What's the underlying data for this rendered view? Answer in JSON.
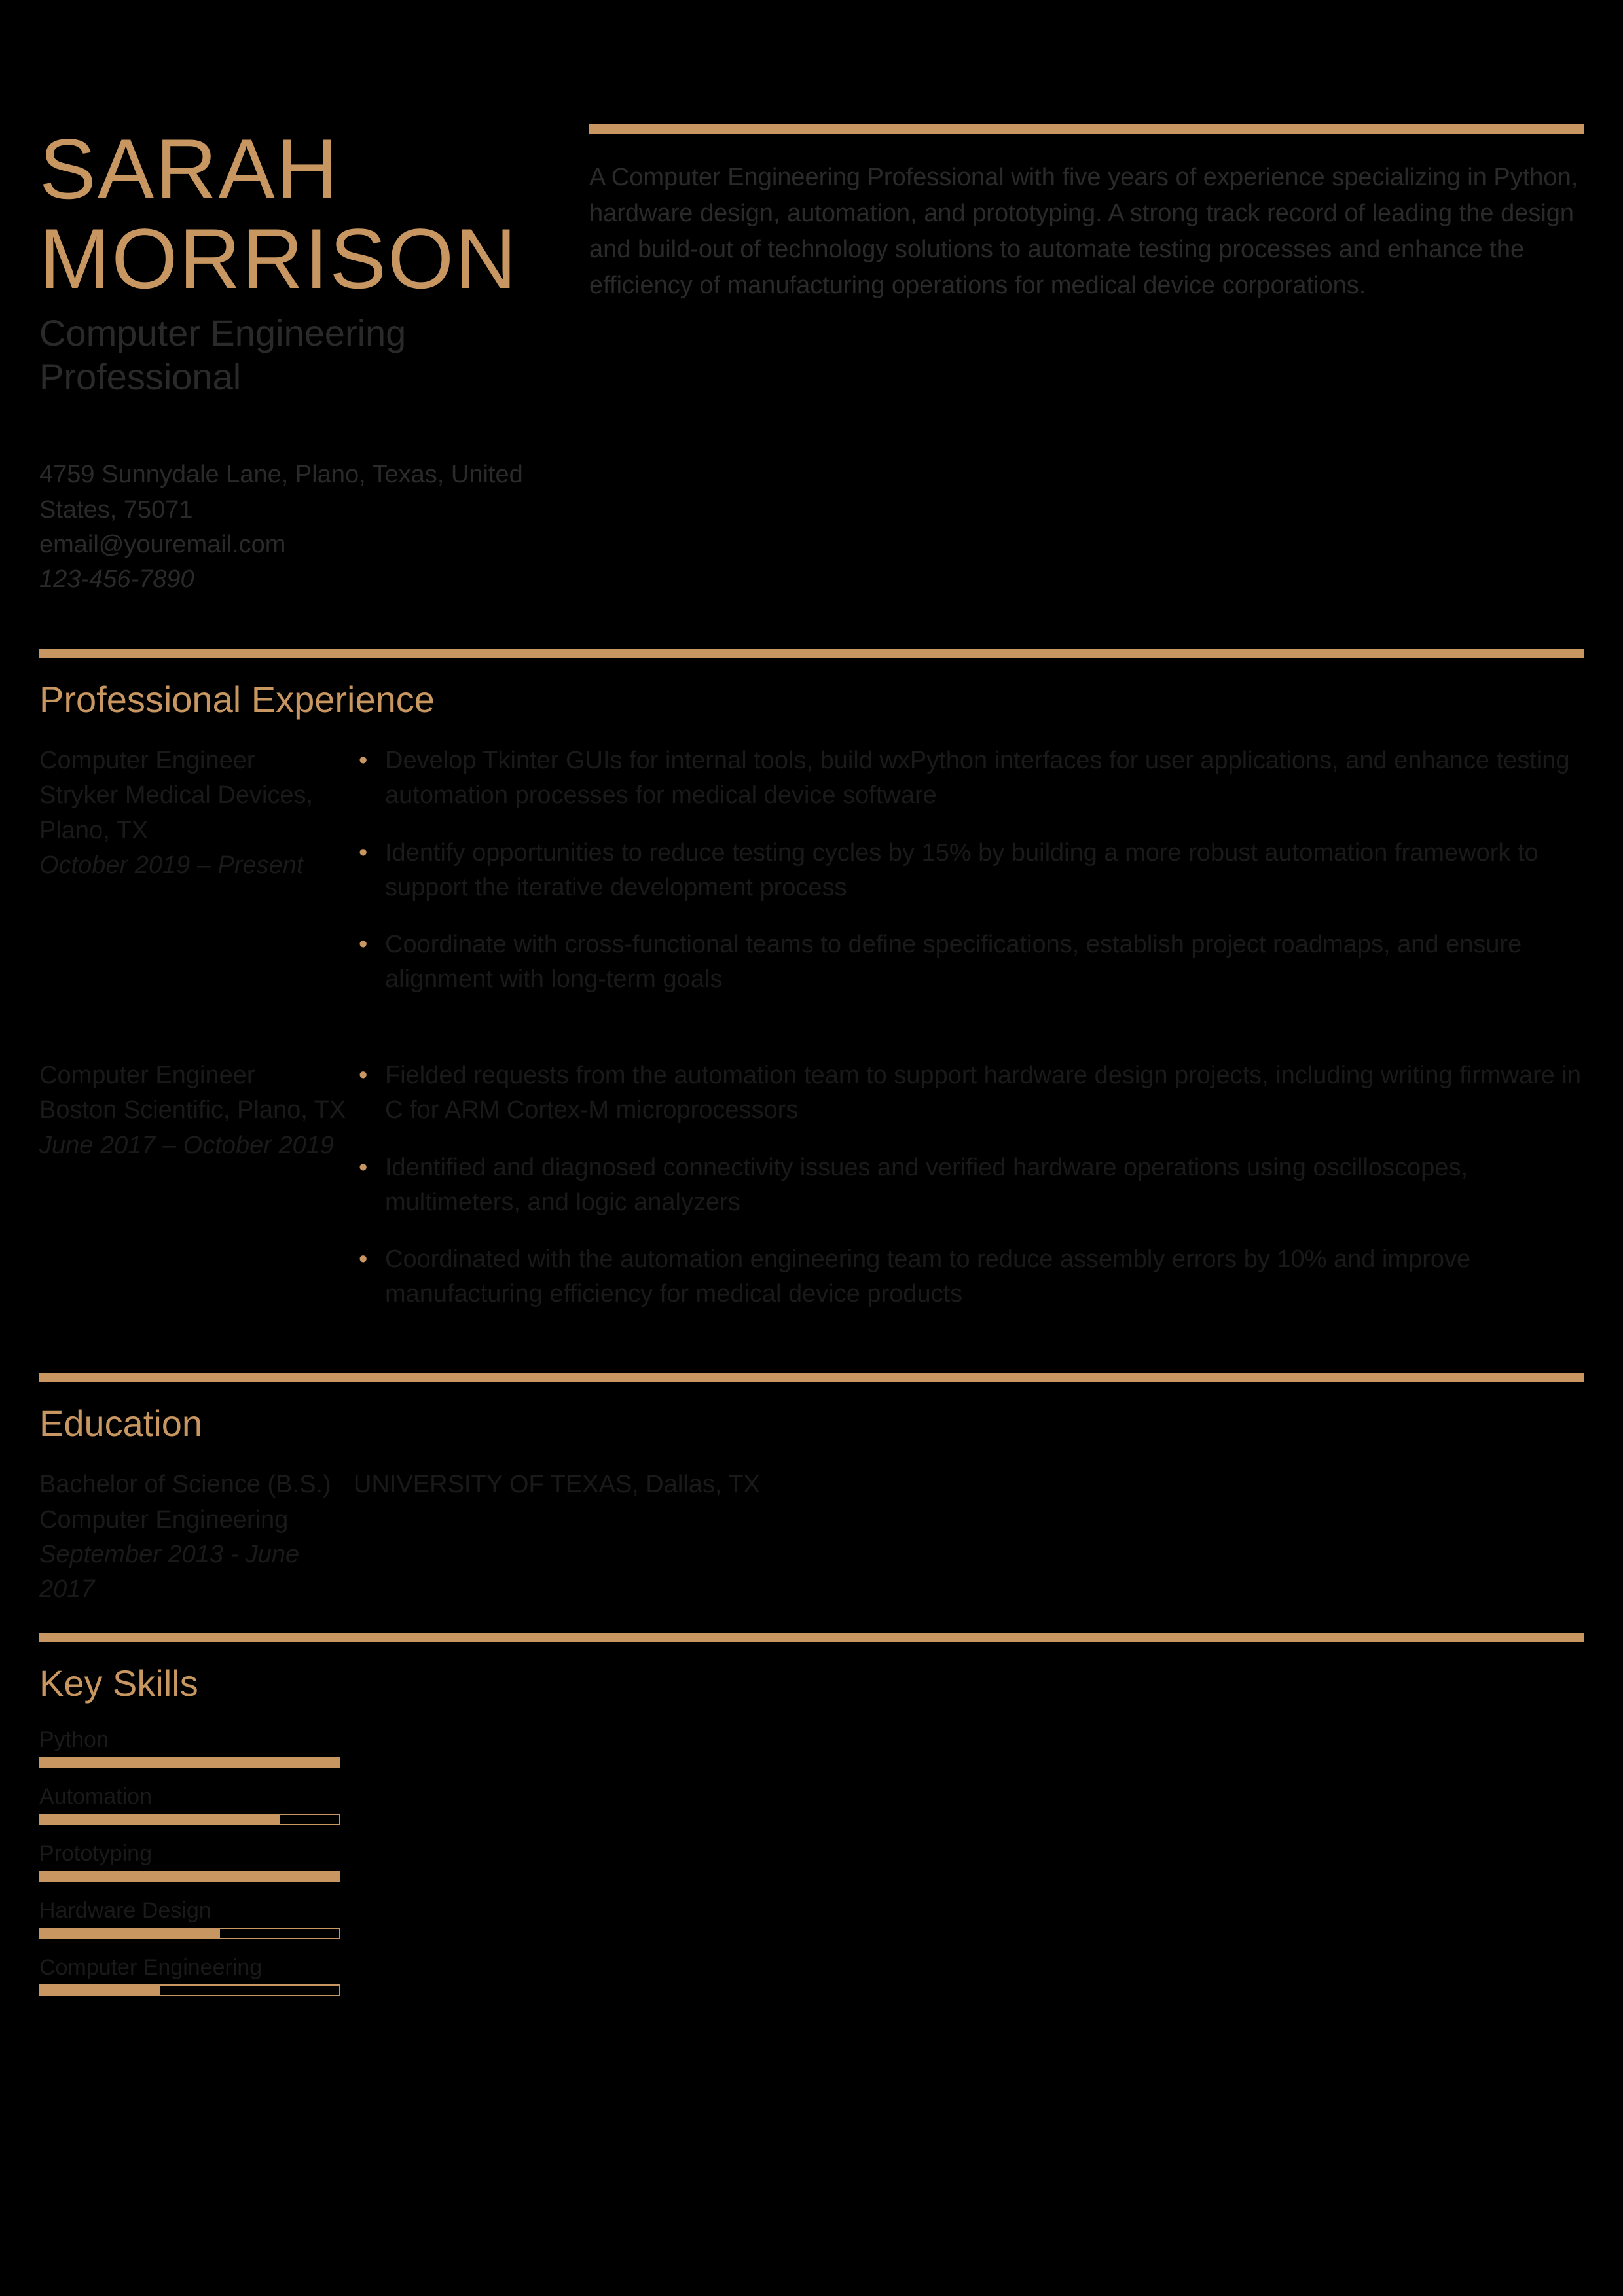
{
  "header": {
    "first_name": "SARAH",
    "last_name": "MORRISON",
    "title": "Computer Engineering Professional",
    "address": "4759 Sunnydale Lane, Plano, Texas, United States, 75071",
    "email": "email@youremail.com",
    "phone": "123-456-7890",
    "summary": "A Computer Engineering Professional with five years of experience specializing in Python, hardware design, automation, and prototyping. A strong track record of leading the design and build-out of technology solutions to automate testing processes and enhance the efficiency of manufacturing operations for medical device corporations."
  },
  "sections": {
    "experience_title": "Professional Experience",
    "education_title": "Education",
    "skills_title": "Key Skills"
  },
  "experience": [
    {
      "title": "Computer Engineer",
      "company": "Stryker Medical Devices, Plano, TX",
      "dates": "October 2019 – Present",
      "bullets": [
        "Develop Tkinter GUIs for internal tools, build wxPython interfaces for user applications, and enhance testing automation processes for medical device software",
        "Identify opportunities to reduce testing cycles by 15% by building a more robust automation framework to support the iterative development process",
        "Coordinate with cross-functional teams to define specifications, establish project roadmaps, and ensure alignment with long-term goals"
      ]
    },
    {
      "title": "Computer Engineer",
      "company": "Boston Scientific, Plano, TX",
      "dates": "June 2017 – October 2019",
      "bullets": [
        "Fielded requests from the automation team to support hardware design projects, including writing firmware in C for ARM Cortex-M microprocessors",
        "Identified and diagnosed connectivity issues and verified hardware operations using oscilloscopes, multimeters, and logic analyzers",
        "Coordinated with the automation engineering team to reduce assembly errors by 10% and improve manufacturing efficiency for medical device products"
      ]
    }
  ],
  "education": [
    {
      "degree": "Bachelor of Science (B.S.) Computer Engineering",
      "dates": "September 2013 - June 2017",
      "school": "UNIVERSITY OF TEXAS, Dallas, TX"
    }
  ],
  "skills": [
    {
      "label": "Python",
      "pct": 100
    },
    {
      "label": "Automation",
      "pct": 80
    },
    {
      "label": "Prototyping",
      "pct": 100
    },
    {
      "label": "Hardware Design",
      "pct": 60
    },
    {
      "label": "Computer Engineering",
      "pct": 40
    }
  ]
}
